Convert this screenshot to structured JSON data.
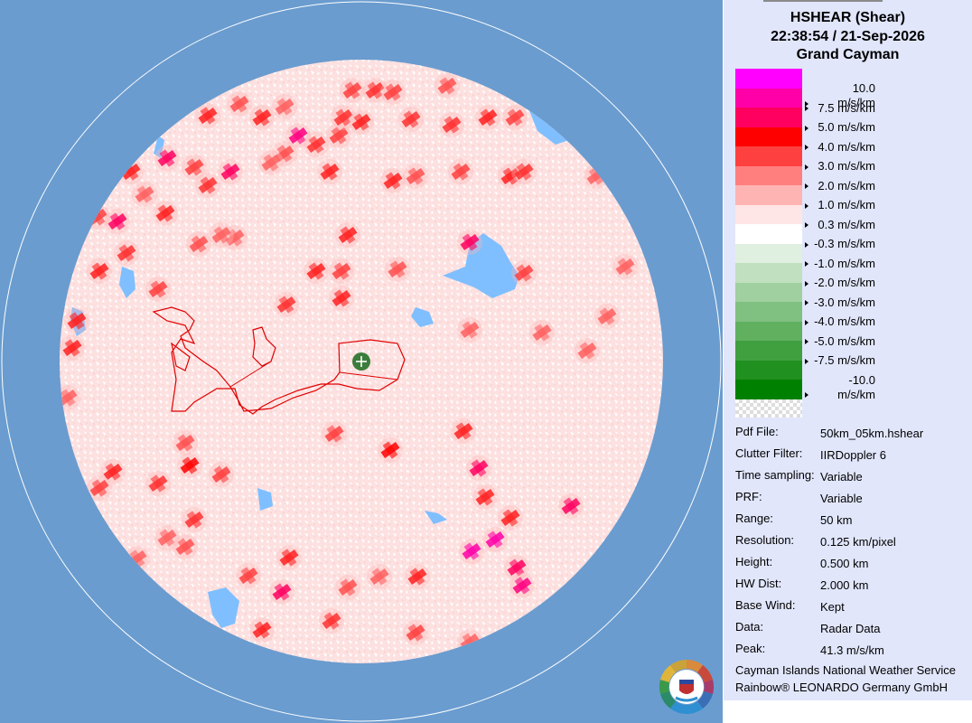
{
  "title": {
    "product": "HSHEAR (Shear)",
    "datetime": "22:38:54 / 21-Sep-2026",
    "site": "Grand Cayman"
  },
  "legend": {
    "items": [
      {
        "label": "10.0 m/s/km",
        "color": "#ff00ff"
      },
      {
        "label": "7.5 m/s/km",
        "color": "#ff00a8"
      },
      {
        "label": "5.0 m/s/km",
        "color": "#ff0060"
      },
      {
        "label": "4.0 m/s/km",
        "color": "#ff0000"
      },
      {
        "label": "3.0 m/s/km",
        "color": "#ff4040"
      },
      {
        "label": "2.0 m/s/km",
        "color": "#ff7f7f"
      },
      {
        "label": "1.0 m/s/km",
        "color": "#ffb4b4"
      },
      {
        "label": "0.3 m/s/km",
        "color": "#ffe6e6"
      },
      {
        "label": "-0.3 m/s/km",
        "color": "#ffffff"
      },
      {
        "label": "-1.0 m/s/km",
        "color": "#e0f0e0"
      },
      {
        "label": "-2.0 m/s/km",
        "color": "#c0e0c0"
      },
      {
        "label": "-3.0 m/s/km",
        "color": "#a0d0a0"
      },
      {
        "label": "-4.0 m/s/km",
        "color": "#80c080"
      },
      {
        "label": "-5.0 m/s/km",
        "color": "#60b060"
      },
      {
        "label": "-7.5 m/s/km",
        "color": "#40a040"
      },
      {
        "label": "-10.0 m/s/km",
        "color": "#209020"
      }
    ],
    "last_color": "#008000"
  },
  "info": [
    {
      "key": "Pdf File:",
      "value": "50km_05km.hshear"
    },
    {
      "key": "Clutter Filter:",
      "value": "IIRDoppler 6"
    },
    {
      "key": "Time sampling:",
      "value": "Variable"
    },
    {
      "key": "PRF:",
      "value": "Variable"
    },
    {
      "key": "Range:",
      "value": "50 km"
    },
    {
      "key": "Resolution:",
      "value": "0.125 km/pixel"
    },
    {
      "key": "Height:",
      "value": "0.500 km"
    },
    {
      "key": "HW Dist:",
      "value": "2.000 km"
    },
    {
      "key": "Base Wind:",
      "value": "Kept"
    },
    {
      "key": "Data:",
      "value": "Radar Data"
    },
    {
      "key": "Peak:",
      "value": "41.3 m/s/km"
    }
  ],
  "footer": {
    "line1": "Cayman Islands National Weather Service",
    "line2": "Rainbow® LEONARDO Germany GmbH"
  },
  "map": {
    "ocean_color": "#6a9ccf",
    "disc_color": "#ffe8e8",
    "water_color": "#7fbfff",
    "coast_color": "#e00000",
    "radar_marker_color": "#3b7d3b"
  }
}
